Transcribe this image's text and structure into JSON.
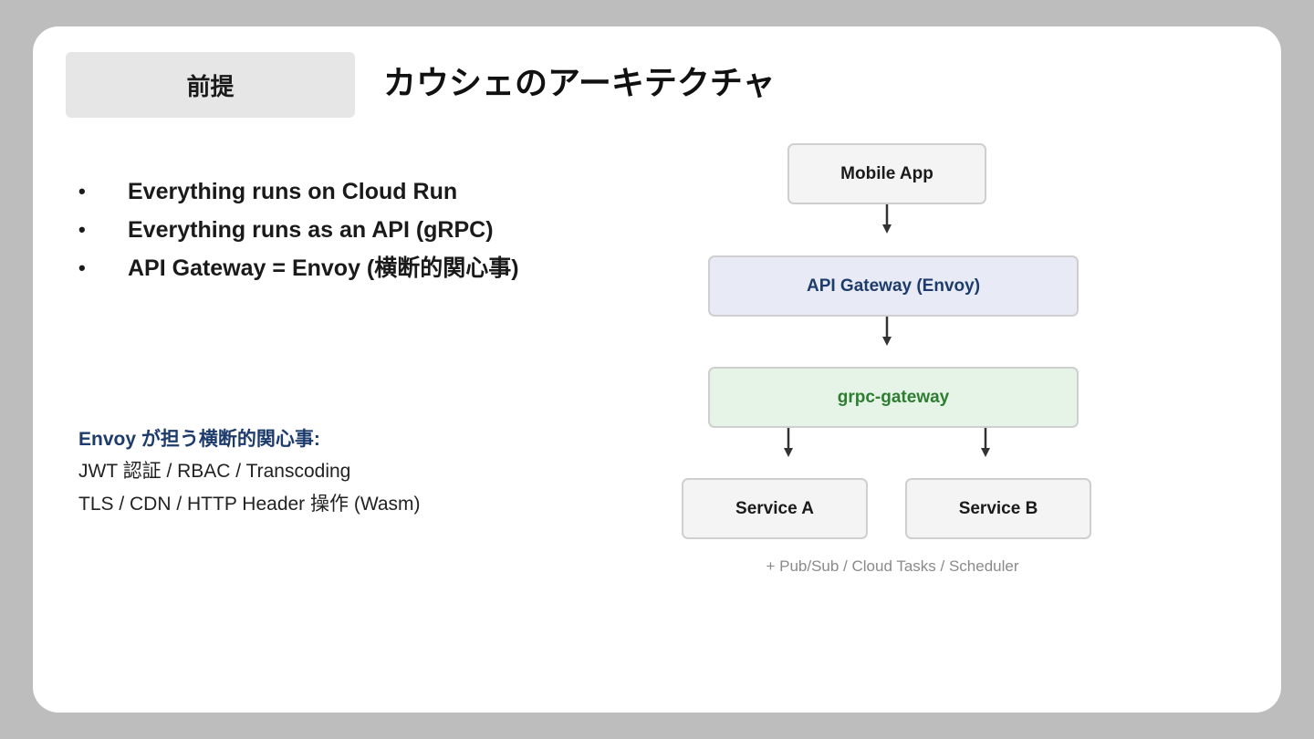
{
  "header": {
    "section_label": "前提",
    "title": "カウシェのアーキテクチャ"
  },
  "bullets": [
    {
      "marker": "•",
      "text": "Everything runs on Cloud Run"
    },
    {
      "marker": "•",
      "text": "Everything runs as an API (gRPC)"
    },
    {
      "marker": "•",
      "text": "API Gateway = Envoy (横断的関心事)"
    }
  ],
  "envoy_concerns": {
    "heading": "Envoy が担う横断的関心事:",
    "lines": [
      "JWT 認証 / RBAC / Transcoding",
      "TLS / CDN / HTTP Header 操作 (Wasm)"
    ]
  },
  "diagram": {
    "nodes": {
      "mobile_app": "Mobile App",
      "api_gateway": "API Gateway (Envoy)",
      "grpc_gateway": "grpc-gateway",
      "service_a": "Service A",
      "service_b": "Service B"
    },
    "footnote": "+ Pub/Sub / Cloud Tasks / Scheduler",
    "colors": {
      "gateway_text": "#1d3b6b",
      "gateway_fill": "#e8ebf6",
      "grpc_text": "#2e7d32",
      "grpc_fill": "#e6f4e7",
      "arrow": "#333333"
    }
  }
}
